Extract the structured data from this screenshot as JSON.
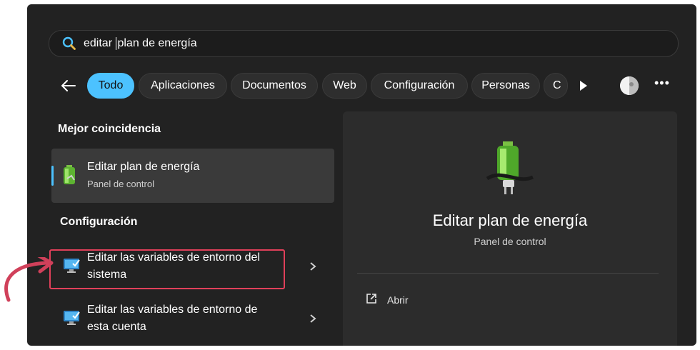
{
  "search": {
    "query_typed": "editar ",
    "query_suggest": "plan de energía"
  },
  "tabs": [
    {
      "label": "Todo",
      "active": true
    },
    {
      "label": "Aplicaciones"
    },
    {
      "label": "Documentos"
    },
    {
      "label": "Web"
    },
    {
      "label": "Configuración"
    },
    {
      "label": "Personas"
    },
    {
      "label": "C"
    }
  ],
  "best_match": {
    "heading": "Mejor coincidencia",
    "title": "Editar plan de energía",
    "subtitle": "Panel de control"
  },
  "settings": {
    "heading": "Configuración",
    "items": [
      {
        "line1": "Editar las variables de entorno del",
        "line2": "sistema"
      },
      {
        "line1": "Editar las variables de entorno de",
        "line2": "esta cuenta"
      }
    ]
  },
  "preview": {
    "title": "Editar plan de energía",
    "subtitle": "Panel de control",
    "actions": [
      {
        "label": "Abrir",
        "icon": "open-external-icon"
      }
    ]
  },
  "colors": {
    "accent": "#4cc2ff",
    "highlight": "#e0405a",
    "background": "#222222"
  }
}
